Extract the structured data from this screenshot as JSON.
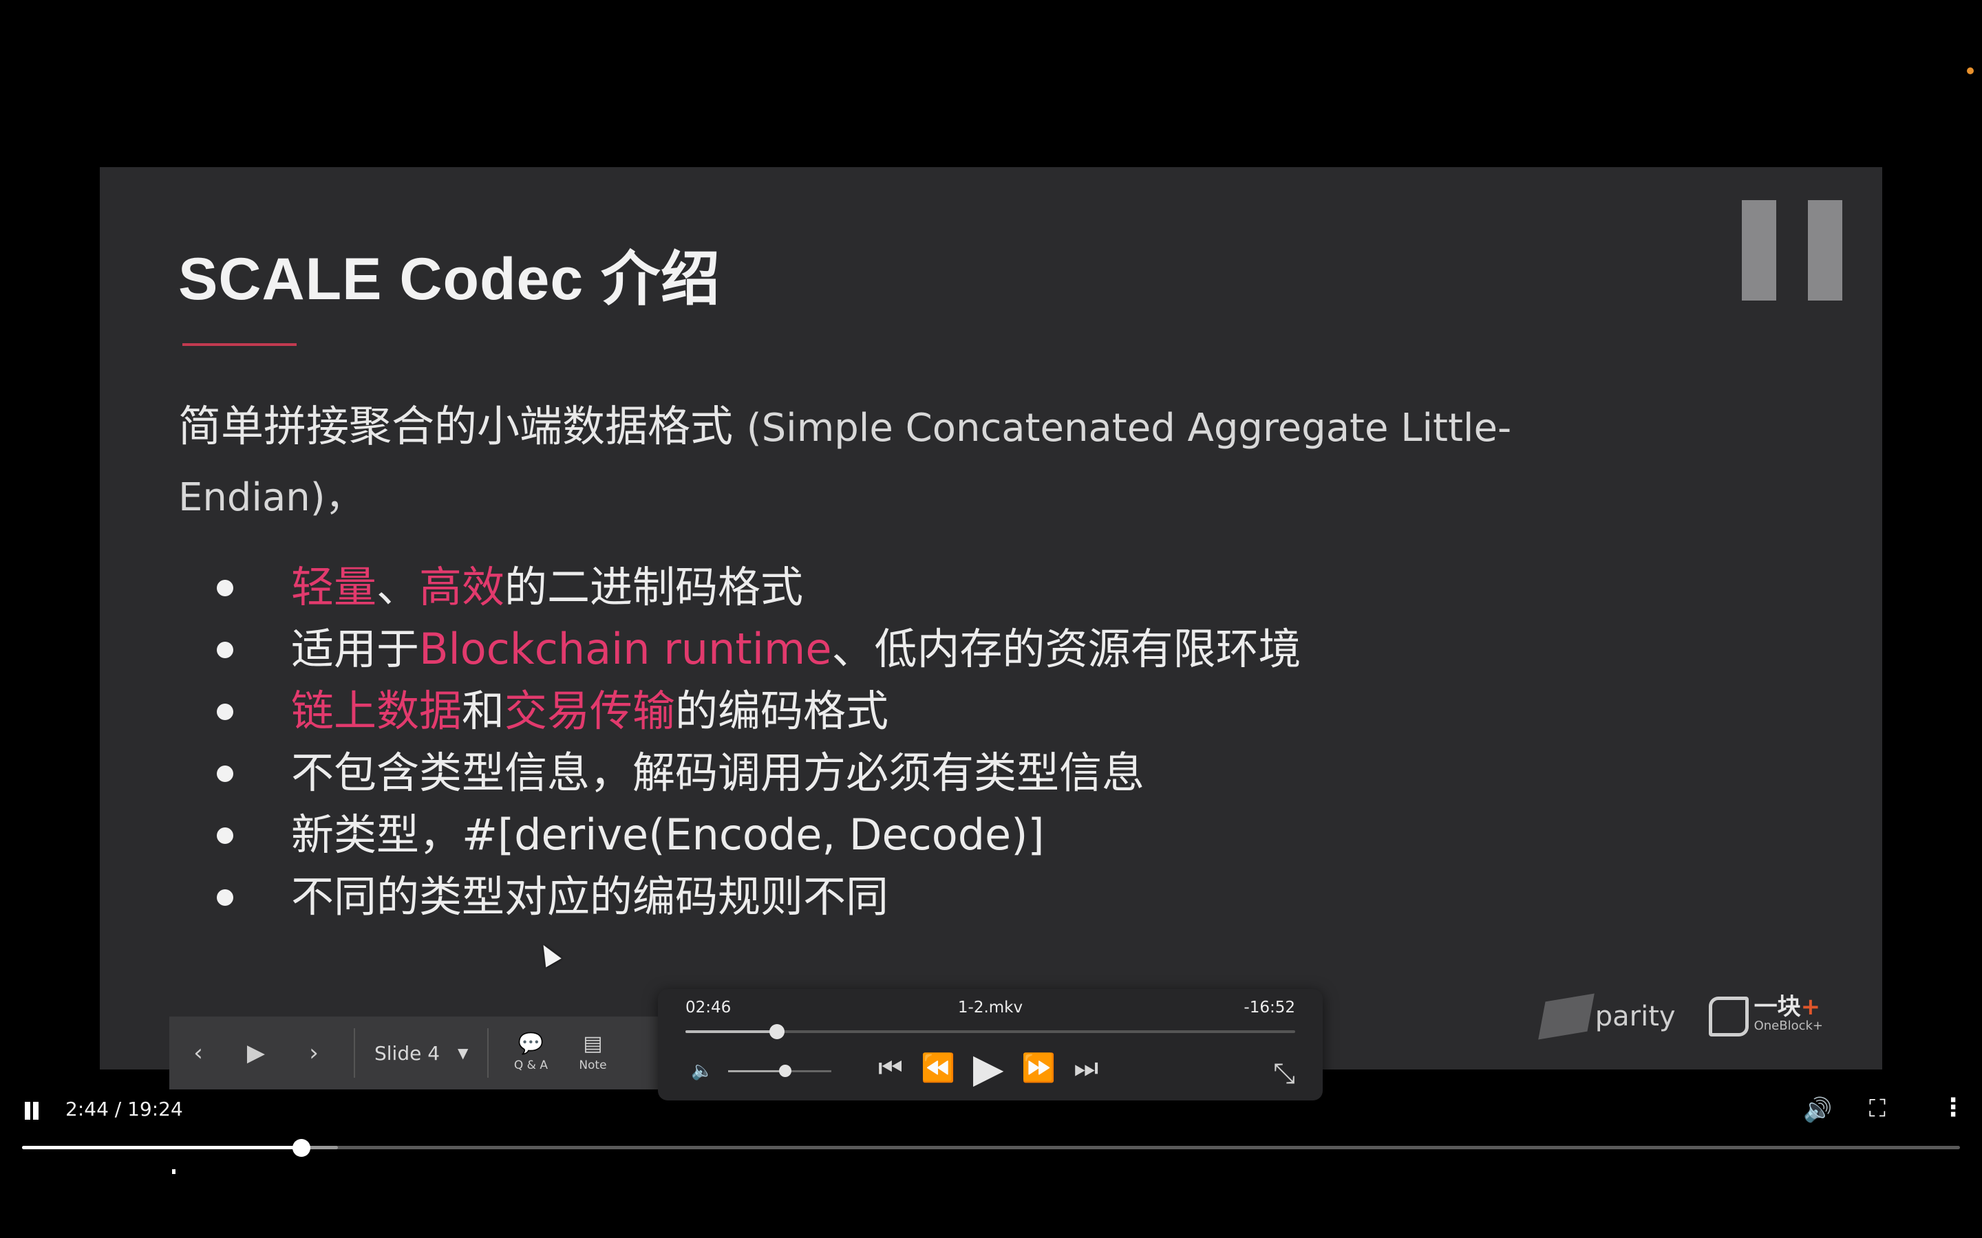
{
  "slide": {
    "title": "SCALE Codec 介绍",
    "intro_cn": "简单拼接聚合的小端数据格式",
    "intro_latin": "(Simple Concatenated Aggregate Little-Endian)，",
    "bullets": [
      {
        "parts": [
          {
            "text": "轻量",
            "hl": true
          },
          {
            "text": "、",
            "hl": false
          },
          {
            "text": "高效",
            "hl": true
          },
          {
            "text": "的二进制码格式",
            "hl": false
          }
        ]
      },
      {
        "parts": [
          {
            "text": "适用于",
            "hl": false
          },
          {
            "text": "Blockchain runtime",
            "hl": true
          },
          {
            "text": "、低内存的资源有限环境",
            "hl": false
          }
        ]
      },
      {
        "parts": [
          {
            "text": "链上数据",
            "hl": true
          },
          {
            "text": "和",
            "hl": false
          },
          {
            "text": "交易传输",
            "hl": true
          },
          {
            "text": "的编码格式",
            "hl": false
          }
        ]
      },
      {
        "parts": [
          {
            "text": "不包含类型信息，解码调用方必须有类型信息",
            "hl": false
          }
        ]
      },
      {
        "parts": [
          {
            "text": "新类型，#[derive(Encode, Decode)]",
            "hl": false
          }
        ]
      },
      {
        "parts": [
          {
            "text": "不同的类型对应的编码规则不同",
            "hl": false
          }
        ]
      }
    ],
    "highlight_color": "#e23a6d",
    "logo_parity": "parity",
    "logo_oneblock_cn": "一块",
    "logo_oneblock_plus": "+",
    "logo_oneblock_en": "OneBlock+"
  },
  "slide_nav": {
    "prev_icon": "‹",
    "play_icon": "▶",
    "next_icon": "›",
    "current_slide": "Slide 4",
    "qa_label": "Q & A",
    "notes_label": "Note"
  },
  "vlc": {
    "elapsed": "02:46",
    "filename": "1-2.mkv",
    "remaining": "-16:52",
    "progress_fraction": 0.15,
    "volume_fraction": 0.55
  },
  "player": {
    "time": "2:44 / 19:24",
    "progress_fraction": 0.144,
    "buffer_fraction": 0.163
  }
}
